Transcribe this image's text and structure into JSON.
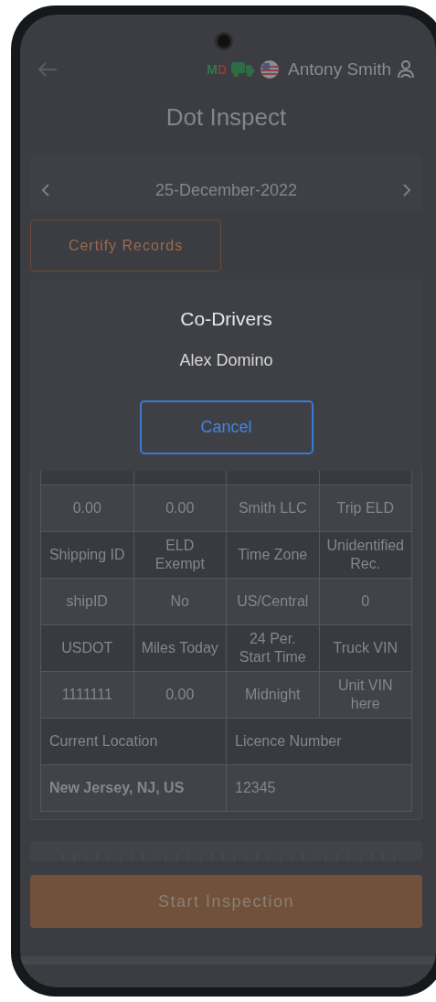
{
  "header": {
    "status_letters": [
      {
        "text": "M",
        "color": "#2f7a4c"
      },
      {
        "text": "D",
        "color": "#8e3b3b"
      }
    ],
    "user_name": "Antony Smith"
  },
  "title": "Dot Inspect",
  "date_nav": {
    "date": "25-December-2022"
  },
  "certify_button": "Certify Records",
  "info_table": {
    "rows": [
      {
        "kind": "value",
        "cells": [
          "0.00",
          "0.00",
          "Smith LLC",
          "Trip ELD"
        ]
      },
      {
        "kind": "label",
        "cells": [
          "Shipping ID",
          "ELD Exempt",
          "Time Zone",
          "Unidentified Rec."
        ]
      },
      {
        "kind": "value",
        "cells": [
          "shipID",
          "No",
          "US/Central",
          "0"
        ]
      },
      {
        "kind": "label",
        "cells": [
          "USDOT",
          "Miles Today",
          "24 Per. Start Time",
          "Truck VIN"
        ]
      },
      {
        "kind": "value",
        "cells": [
          "1111111",
          "0.00",
          "Midnight",
          "Unit VIN here"
        ]
      },
      {
        "kind": "label",
        "cells": [
          "Current Location",
          "Licence Number"
        ]
      },
      {
        "kind": "value",
        "cells": [
          "New Jersey, NJ, US",
          "12345"
        ]
      }
    ]
  },
  "start_button": "Start Inspection",
  "dialog": {
    "title": "Co-Drivers",
    "drivers": [
      "Alex Domino"
    ],
    "cancel_button": "Cancel"
  }
}
